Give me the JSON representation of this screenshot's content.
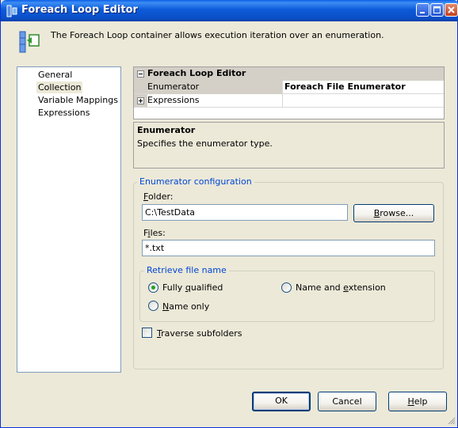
{
  "window": {
    "title": "Foreach Loop Editor",
    "colors": {
      "titlebar": "#0A4FC7",
      "face": "#ECE9D8",
      "accent_text": "#0046D5"
    }
  },
  "header": {
    "description": "The Foreach Loop container allows execution iteration over an enumeration.",
    "icon": "foreach-loop-icon"
  },
  "nav": {
    "items": [
      {
        "label": "General",
        "selected": false
      },
      {
        "label": "Collection",
        "selected": true
      },
      {
        "label": "Variable Mappings",
        "selected": false
      },
      {
        "label": "Expressions",
        "selected": false
      }
    ]
  },
  "property_grid": {
    "category": "Foreach Loop Editor",
    "rows": [
      {
        "name": "Enumerator",
        "value": "Foreach File Enumerator"
      },
      {
        "name": "Expressions",
        "value": ""
      }
    ]
  },
  "description_panel": {
    "title": "Enumerator",
    "text": "Specifies the enumerator type."
  },
  "enumerator_config": {
    "legend": "Enumerator configuration",
    "folder_label": "Folder:",
    "folder_accel": "F",
    "folder_rest": "older:",
    "folder_value": "C:\\TestData",
    "browse_label": "Browse...",
    "browse_accel": "B",
    "browse_rest": "rowse...",
    "files_label": "Files:",
    "files_pre": "F",
    "files_accel": "i",
    "files_rest": "les:",
    "files_value": "*.txt",
    "retrieve_legend": "Retrieve file name",
    "options": {
      "fully_qualified": {
        "label": "Fully qualified",
        "pre": "Fully ",
        "accel": "q",
        "rest": "ualified",
        "checked": true
      },
      "name_extension": {
        "label": "Name and extension",
        "pre": "Name and ",
        "accel": "e",
        "rest": "xtension",
        "checked": false
      },
      "name_only": {
        "label": "Name only",
        "pre": "",
        "accel": "N",
        "rest": "ame only",
        "checked": false
      }
    },
    "traverse_label": "Traverse subfolders",
    "traverse_accel": "T",
    "traverse_rest": "raverse subfolders",
    "traverse_checked": false
  },
  "footer": {
    "ok_label": "OK",
    "cancel_label": "Cancel",
    "help_label": "Help",
    "help_accel": "H",
    "help_rest": "elp"
  }
}
